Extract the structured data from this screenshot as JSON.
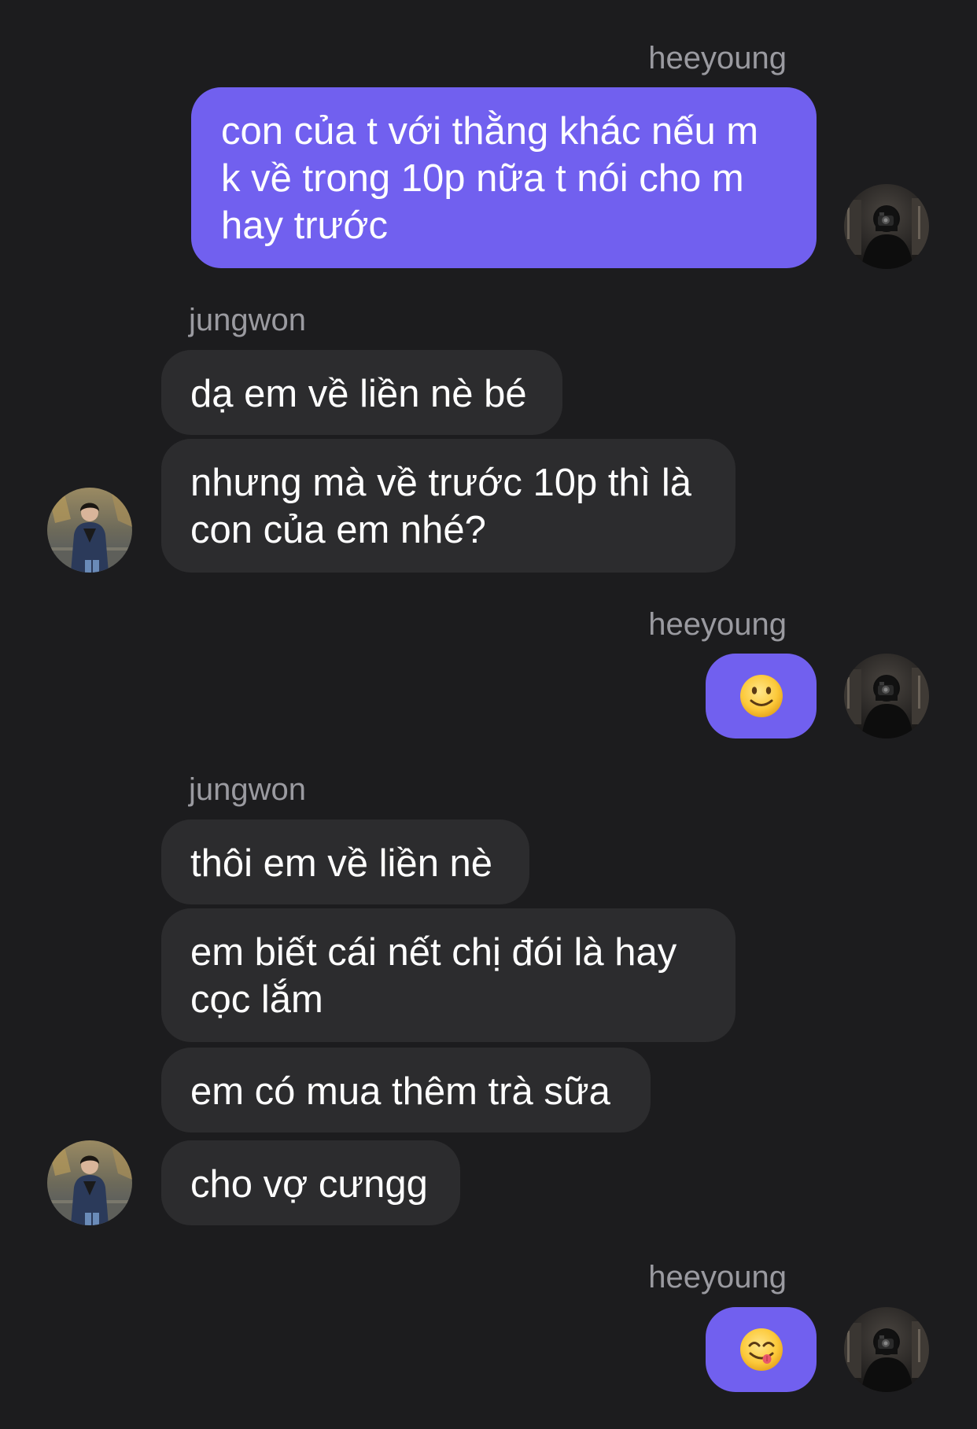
{
  "conversation": {
    "participants": {
      "me": "heeyoung",
      "other": "jungwon"
    },
    "groups": [
      {
        "sender": "heeyoung",
        "messages": [
          "con của t với thằng khác nếu m k về trong 10p nữa t nói cho m hay trước"
        ]
      },
      {
        "sender": "jungwon",
        "messages": [
          "dạ em về liền nè bé",
          "nhưng mà về trước 10p thì là con của em nhé?"
        ]
      },
      {
        "sender": "heeyoung",
        "messages": [
          "🙂"
        ]
      },
      {
        "sender": "jungwon",
        "messages": [
          "thôi em về liền nè",
          "em biết cái nết chị đói là hay cọc lắm",
          "em có mua thêm trà sữa",
          "cho vợ cưngg"
        ]
      },
      {
        "sender": "heeyoung",
        "messages": [
          "😋"
        ]
      }
    ]
  },
  "colors": {
    "background": "#1c1c1e",
    "outgoing_bubble": "#7160ef",
    "incoming_bubble": "#2c2c2e",
    "sender_name": "#9a9aa0",
    "message_text": "#ffffff"
  },
  "icons": {
    "outgoing_avatar": "avatar-heeyoung-photo",
    "incoming_avatar": "avatar-jungwon-photo"
  }
}
